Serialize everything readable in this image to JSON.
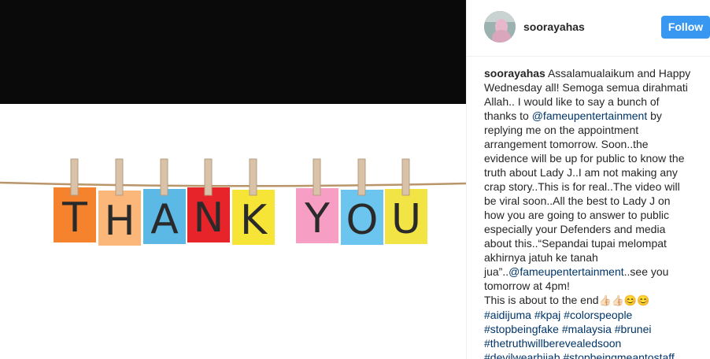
{
  "post": {
    "username": "soorayahas",
    "follow_label": "Follow"
  },
  "caption": {
    "username": "soorayahas",
    "lines": [
      "Assalamualaikum and Happy",
      "Wednesday all! Semoga semua dirahmati",
      "Allah.. I would like to say a bunch of",
      "thanks to",
      "@fameupentertainment",
      "by",
      "replying me on the appointment",
      "arrangement tomorrow. Soon..the",
      "evidence will be up for public to know the",
      "truth about Lady J..I am not making any",
      "crap story..This is for real..The video will",
      "be viral soon..All the best to Lady J on",
      "how you are going to answer to public",
      "especially your Defenders and media",
      "about this..“Sepandai tupai melompat",
      "akhirnya jatuh ke tanah",
      "jua”..",
      "@fameupentertainment",
      "..see you",
      "tomorrow at 4pm!",
      "This is about to the end",
      "👍🏻👍🏻😊😊"
    ],
    "hashtags_1": "#aidijuma #kpaj #colorspeople",
    "hashtags_2": "#stopbeingfake #malaysia #brunei",
    "hashtags_3": "#thetruthwillberevealedsoon",
    "hashtags_4": "#devilwearhijab #stopbeingmeantostaff"
  },
  "image": {
    "letters": [
      "T",
      "H",
      "A",
      "N",
      "K",
      "Y",
      "O",
      "U"
    ],
    "colors": [
      "#f5822d",
      "#fbb679",
      "#5cb8e4",
      "#e8242b",
      "#f6e436",
      "#f79ec4",
      "#6cc5ee",
      "#f2e445"
    ]
  }
}
